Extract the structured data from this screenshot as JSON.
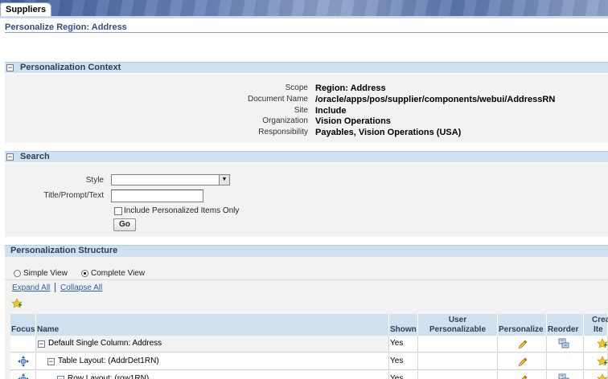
{
  "header": {
    "tab_label": "Suppliers"
  },
  "page": {
    "title": "Personalize Region: Address"
  },
  "context": {
    "title": "Personalization Context",
    "rows": [
      {
        "label": "Scope",
        "value": "Region: Address"
      },
      {
        "label": "Document Name",
        "value": "/oracle/apps/pos/supplier/components/webui/AddressRN"
      },
      {
        "label": "Site",
        "value": "Include"
      },
      {
        "label": "Organization",
        "value": "Vision Operations"
      },
      {
        "label": "Responsibility",
        "value": "Payables, Vision Operations (USA)"
      }
    ]
  },
  "search": {
    "title": "Search",
    "style_label": "Style",
    "style_value": "",
    "title_prompt_label": "Title/Prompt/Text",
    "title_prompt_value": "",
    "include_label": "Include Personalized Items Only",
    "go_label": "Go"
  },
  "structure": {
    "title": "Personalization Structure",
    "simple_view": "Simple View",
    "complete_view": "Complete View",
    "selected_view": "Complete View",
    "expand_all": "Expand All",
    "collapse_all": "Collapse All",
    "columns": {
      "focus": "Focus",
      "name": "Name",
      "shown": "Shown",
      "user_personalizable": "User Personalizable",
      "user_line1": "User",
      "user_line2": "Personalizable",
      "personalize": "Personalize",
      "reorder": "Reorder",
      "create_line1": "Crea",
      "create_line2": "Ite"
    },
    "rows": [
      {
        "name": "Default Single Column: Address",
        "shown": "Yes",
        "focus": false,
        "reorder": true
      },
      {
        "name": "Table Layout: (AddrDet1RN)",
        "shown": "Yes",
        "focus": true,
        "reorder": false
      },
      {
        "name": "Row Layout: (row1RN)",
        "shown": "Yes",
        "focus": true,
        "reorder": true
      }
    ]
  }
}
